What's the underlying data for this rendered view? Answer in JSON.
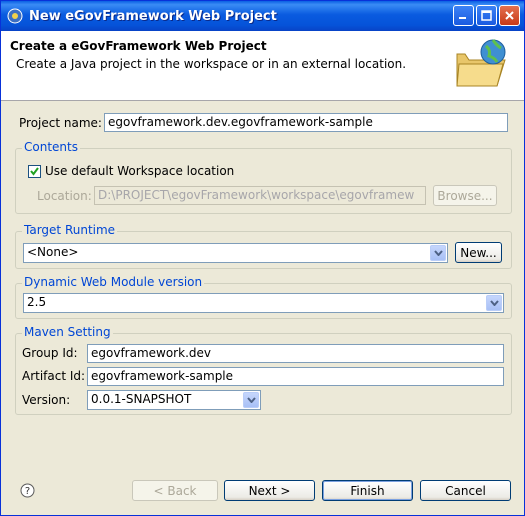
{
  "window": {
    "title": "New eGovFramework Web Project"
  },
  "header": {
    "title": "Create a eGovFramework Web Project",
    "description": "Create a Java project in the workspace or in an external location."
  },
  "project_name": {
    "label": "Project name:",
    "value": "egovframework.dev.egovframework-sample"
  },
  "contents": {
    "group_title": "Contents",
    "use_default_label": "Use default Workspace location",
    "use_default_checked": true,
    "location_label": "Location:",
    "location_value": "D:\\PROJECT\\egovFramework\\workspace\\egovframew",
    "browse_label": "Browse..."
  },
  "target_runtime": {
    "group_title": "Target Runtime",
    "selected": "<None>",
    "new_label": "New..."
  },
  "dynamic_web_module": {
    "group_title": "Dynamic Web Module version",
    "selected": "2.5"
  },
  "maven": {
    "group_title": "Maven Setting",
    "group_id_label": "Group Id:",
    "group_id_value": "egovframework.dev",
    "artifact_id_label": "Artifact Id:",
    "artifact_id_value": "egovframework-sample",
    "version_label": "Version:",
    "version_value": "0.0.1-SNAPSHOT"
  },
  "footer": {
    "back_label": "< Back",
    "next_label": "Next >",
    "finish_label": "Finish",
    "cancel_label": "Cancel"
  },
  "colors": {
    "titlebar": "#0a5be0",
    "group_title": "#0046d5",
    "dialog_bg": "#ece9d8"
  }
}
